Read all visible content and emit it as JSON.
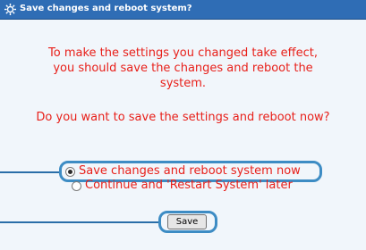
{
  "dialog": {
    "title": "Save changes and reboot system?",
    "icon": "settings-gear-icon"
  },
  "message": {
    "line1": "To make the settings you changed take effect,",
    "line2": "you should save the changes and reboot the",
    "line3": "system.",
    "question": "Do you want to save the settings and reboot now?"
  },
  "options": [
    {
      "label": "Save changes and reboot system now",
      "selected": true
    },
    {
      "label": "Continue and 'Restart System' later",
      "selected": false
    }
  ],
  "save_button": {
    "label": "Save"
  },
  "colors": {
    "titlebar": "#2f6db5",
    "message_text": "#e8201a",
    "highlight": "#3d8cc4",
    "background": "#f1f6fb"
  }
}
